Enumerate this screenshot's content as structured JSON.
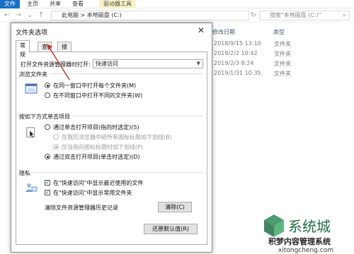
{
  "ribbon": {
    "tabs": [
      "文件",
      "主页",
      "共享",
      "查看",
      "驱动器工具"
    ]
  },
  "address": {
    "path": "此电脑 > 本地磁盘 (C:)",
    "search_placeholder": "搜索\"本地磁盘 (C:)\""
  },
  "file_list": {
    "headers": {
      "date": "修改日期",
      "type": "类型"
    },
    "rows": [
      {
        "date": "2018/9/15 13:10",
        "type": "文件夹"
      },
      {
        "date": "2019/2/2 10:42",
        "type": "文件夹"
      },
      {
        "date": "2019/2/3 8:24",
        "type": "文件夹"
      },
      {
        "date": "2019/1/31 10:35",
        "type": "文件夹"
      }
    ]
  },
  "dialog": {
    "title": "文件夹选项",
    "close": "✕",
    "tabs": [
      "常规",
      "查看",
      "搜索"
    ],
    "open_label": "打开文件资源管理器时打开:",
    "open_value": "快速访问",
    "browse": {
      "title": "浏览文件夹",
      "opt1": "在同一窗口中打开每个文件夹(M)",
      "opt2": "在不同窗口中打开不同的文件夹(W)"
    },
    "click": {
      "title": "按如下方式单击项目",
      "opt1": "通过单击打开项目(指向时选定)(S)",
      "sub1": "在我的浏览器中给所有图标标题加下划线(B)",
      "sub2": "仅当指向图标标题时加下划线(P)",
      "opt2": "通过双击打开项目(单击时选定)(D)"
    },
    "privacy": {
      "title": "隐私",
      "chk1": "在\"快速访问\"中显示最近使用的文件",
      "chk2": "在\"快速访问\"中显示常用文件夹",
      "clear_label": "清除文件资源管理器历史记录",
      "clear_button": "清除(C)"
    },
    "restore_button": "还原默认值(R)"
  },
  "watermark": {
    "brand": "系统城",
    "line1": "积梦内容管理系统",
    "line2": "xitongcheng.com"
  },
  "colors": {
    "accent": "#1a6fc7",
    "annotation": "#c0392b"
  }
}
